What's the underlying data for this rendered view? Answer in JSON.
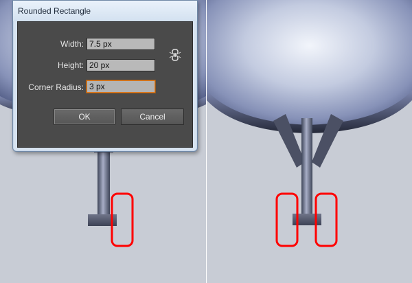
{
  "dialog": {
    "title": "Rounded Rectangle",
    "width_label": "Width:",
    "width_value": "7.5 px",
    "height_label": "Height:",
    "height_value": "20 px",
    "radius_label": "Corner Radius:",
    "radius_value": "3 px",
    "ok_label": "OK",
    "cancel_label": "Cancel"
  },
  "icons": {
    "constrain": "link-proportions-icon"
  },
  "colors": {
    "canvas_bg": "#c8ccd5",
    "highlight": "#ff0000",
    "focus": "#e47b1b"
  }
}
